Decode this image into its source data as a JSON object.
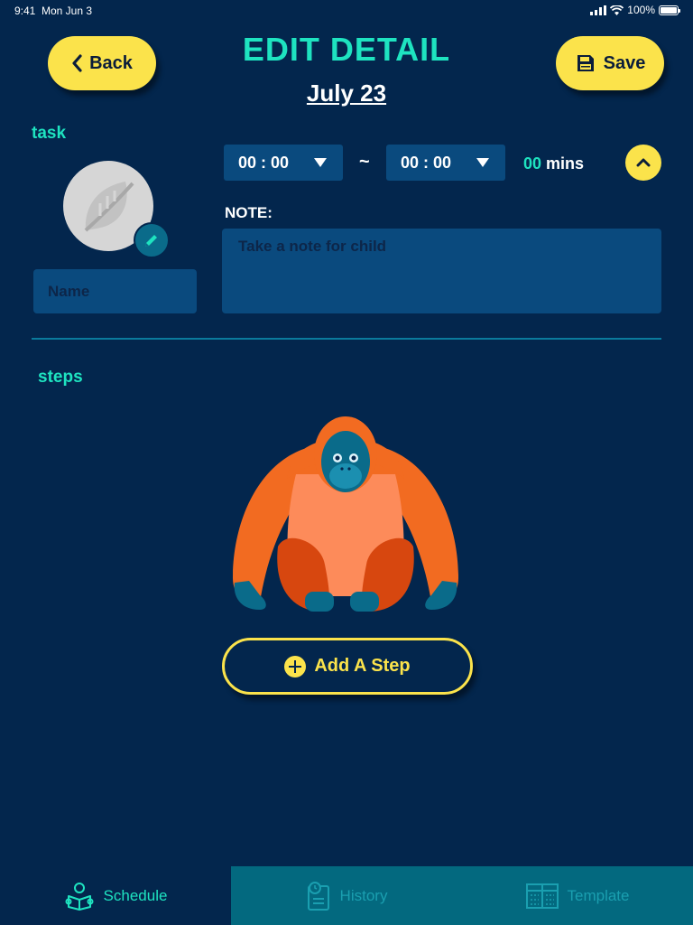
{
  "status_bar": {
    "time": "9:41",
    "date": "Mon Jun 3",
    "battery": "100%"
  },
  "header": {
    "back_label": "Back",
    "title": "EDIT DETAIL",
    "date": "July 23",
    "save_label": "Save"
  },
  "task": {
    "section_label": "task",
    "name_placeholder": "Name",
    "start_time": "00 :  00",
    "separator": "~",
    "end_time": "00 :  00",
    "duration_value": "00",
    "duration_unit": "mins",
    "note_label": "NOTE:",
    "note_placeholder": "Take a note for child"
  },
  "steps": {
    "section_label": "steps",
    "add_step_label": "Add A Step"
  },
  "tabs": [
    {
      "label": "Schedule",
      "icon": "reading-child-icon",
      "active": true
    },
    {
      "label": "History",
      "icon": "clipboard-clock-icon",
      "active": false
    },
    {
      "label": "Template",
      "icon": "grid-template-icon",
      "active": false
    }
  ],
  "colors": {
    "background": "#03264d",
    "accent_teal": "#1ee3c0",
    "accent_yellow": "#fbe34b",
    "field_blue": "#0a4a7e",
    "tab_inactive": "#03697f"
  }
}
